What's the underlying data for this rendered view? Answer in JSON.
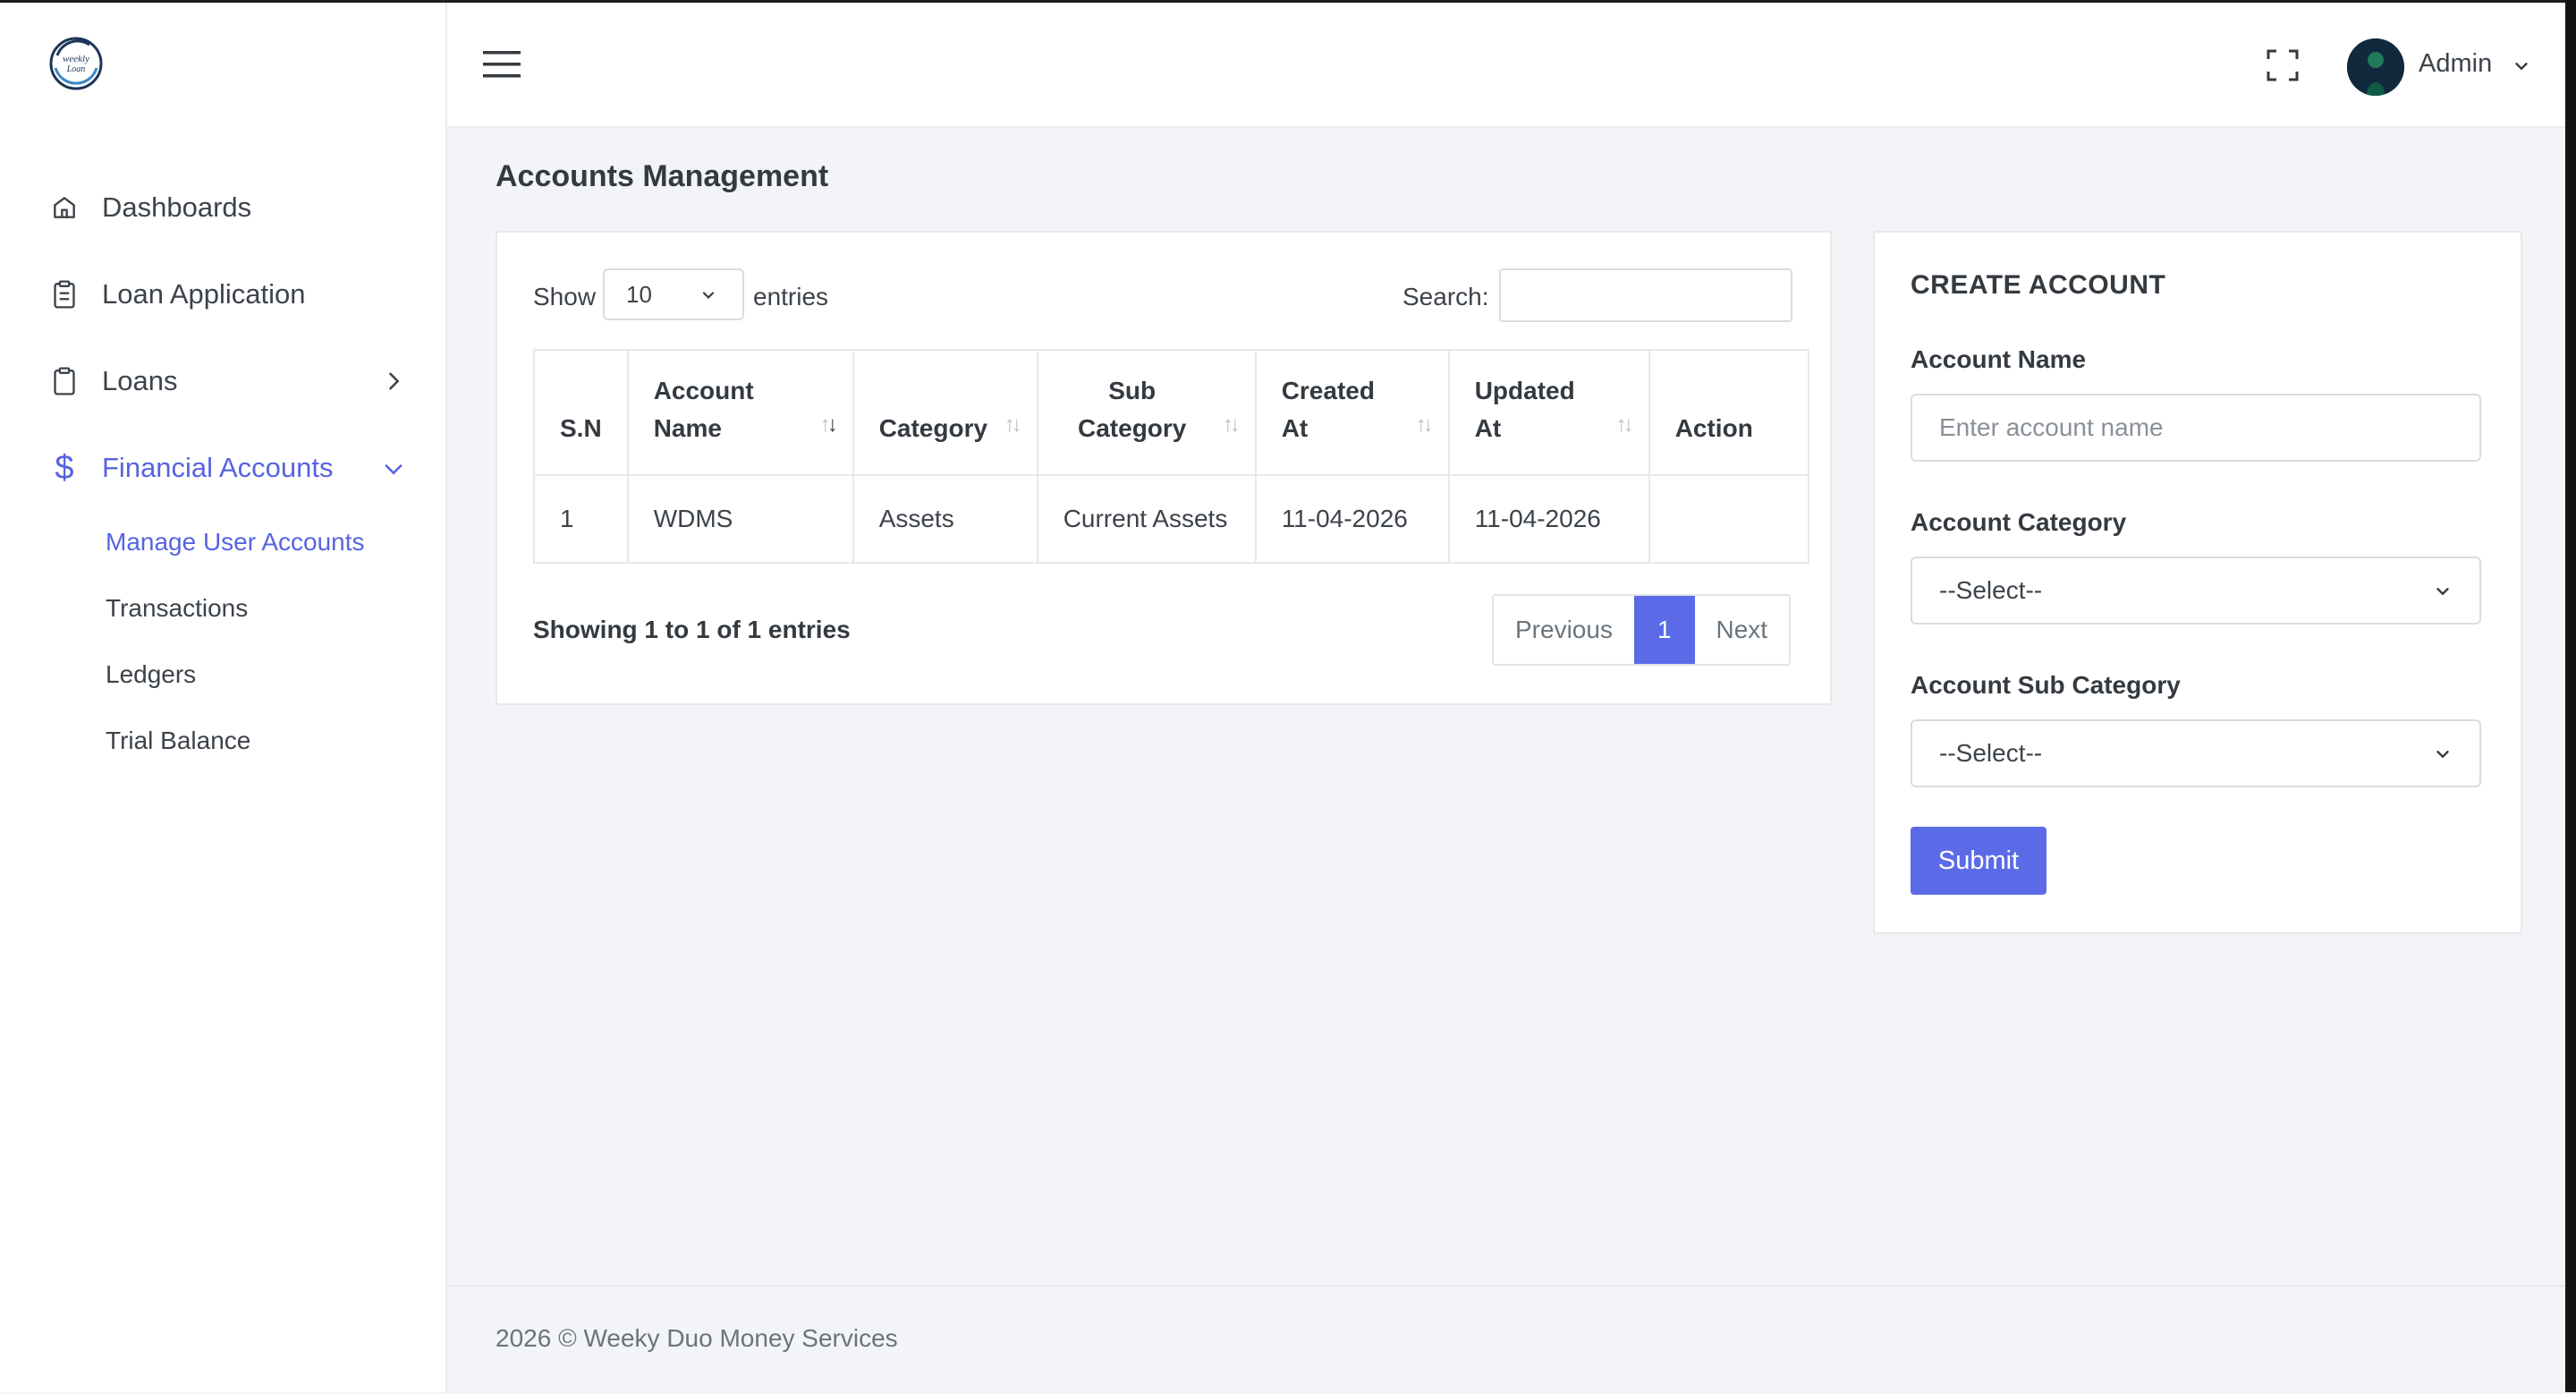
{
  "brand": {
    "logo_text": "weekly Loan"
  },
  "sidebar": {
    "items": [
      {
        "label": "Dashboards",
        "icon": "home-icon"
      },
      {
        "label": "Loan Application",
        "icon": "clipboard-list-icon"
      },
      {
        "label": "Loans",
        "icon": "clipboard-icon"
      },
      {
        "label": "Financial Accounts",
        "icon": "dollar-icon"
      }
    ],
    "sub_items": [
      {
        "label": "Manage User Accounts"
      },
      {
        "label": "Transactions"
      },
      {
        "label": "Ledgers"
      },
      {
        "label": "Trial Balance"
      }
    ]
  },
  "header": {
    "user_name": "Admin"
  },
  "page": {
    "title": "Accounts Management"
  },
  "table": {
    "show_label": "Show",
    "page_length": "10",
    "entries_label": "entries",
    "search_label": "Search:",
    "search_value": "",
    "columns": [
      {
        "line1": "",
        "line2": "S.N"
      },
      {
        "line1": "Account",
        "line2": "Name"
      },
      {
        "line1": "",
        "line2": "Category"
      },
      {
        "line1": "Sub",
        "line2": "Category"
      },
      {
        "line1": "Created",
        "line2": "At"
      },
      {
        "line1": "Updated",
        "line2": "At"
      },
      {
        "line1": "",
        "line2": "Action"
      }
    ],
    "rows": [
      {
        "sn": "1",
        "account_name": "WDMS",
        "category": "Assets",
        "sub_category": "Current Assets",
        "created_at": "11-04-2026",
        "updated_at": "11-04-2026",
        "action": ""
      }
    ],
    "info": "Showing 1 to 1 of 1 entries",
    "pagination": {
      "previous": "Previous",
      "current": "1",
      "next": "Next"
    }
  },
  "create_account": {
    "title": "CREATE ACCOUNT",
    "account_name_label": "Account Name",
    "account_name_placeholder": "Enter account name",
    "category_label": "Account Category",
    "category_value": "--Select--",
    "sub_category_label": "Account Sub Category",
    "sub_category_value": "--Select--",
    "submit_label": "Submit"
  },
  "footer": {
    "text": "2026 © Weeky Duo Money Services"
  },
  "colors": {
    "accent": "#5b6be8",
    "active_nav": "#5764e0",
    "avatar_bg": "#12283d"
  }
}
